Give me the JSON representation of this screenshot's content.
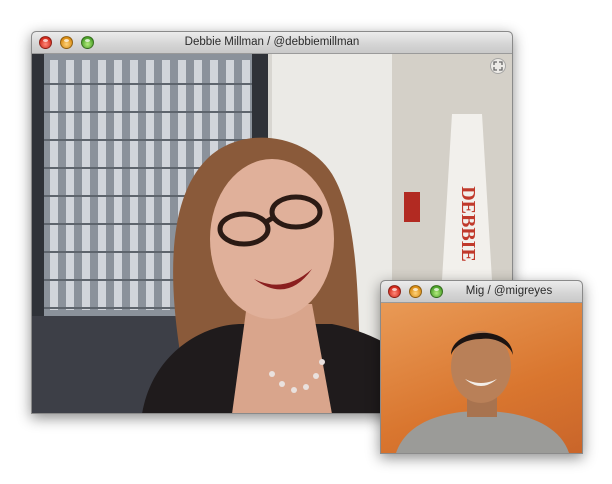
{
  "main_window": {
    "title": "Debbie Millman / @debbiemillman",
    "background_sign_text": "DEBBIE"
  },
  "pip_window": {
    "title": "Mig / @migreyes"
  },
  "icons": {
    "close": "close-icon",
    "minimize": "minimize-icon",
    "zoom": "zoom-icon",
    "fullscreen": "fullscreen-icon"
  },
  "colors": {
    "close": "#d2281a",
    "minimize": "#d98c12",
    "zoom": "#4ba12a",
    "pip_background": "#d9762f"
  }
}
